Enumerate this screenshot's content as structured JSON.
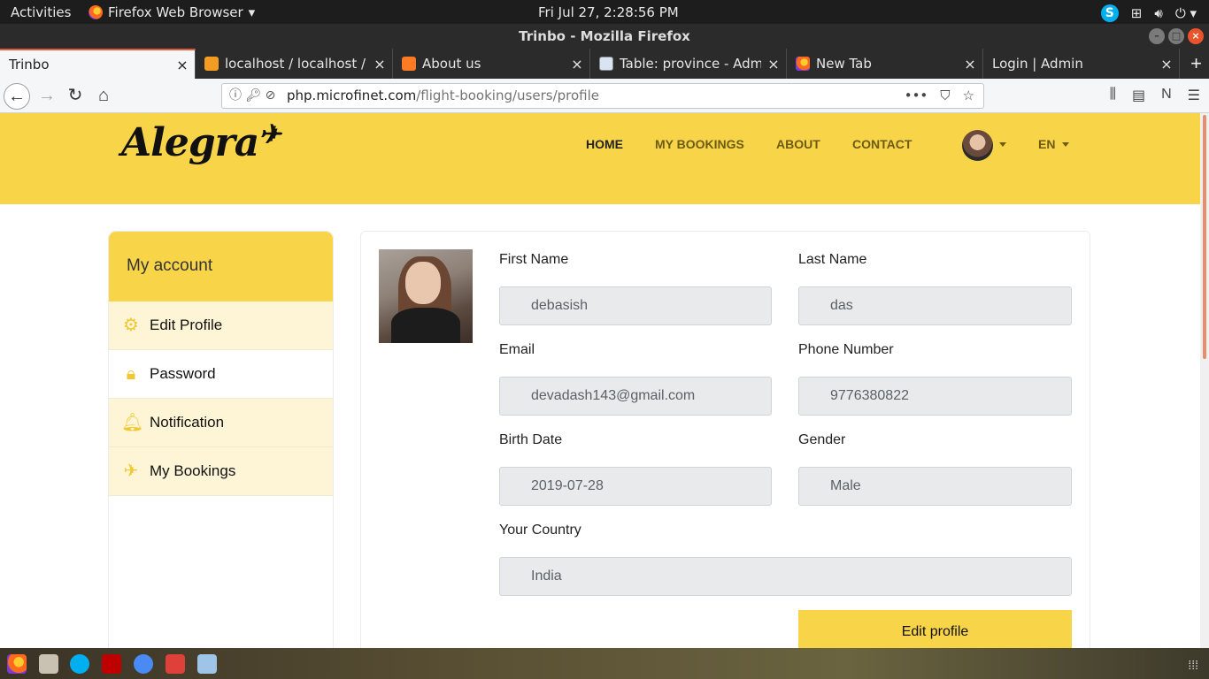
{
  "system": {
    "activities": "Activities",
    "app_menu": "Firefox Web Browser",
    "clock": "Fri Jul 27,  2:28:56 PM"
  },
  "window": {
    "title": "Trinbo - Mozilla Firefox"
  },
  "tabs": [
    {
      "title": "Trinbo",
      "active": true
    },
    {
      "title": "localhost / localhost / fli"
    },
    {
      "title": "About us"
    },
    {
      "title": "Table: province - Admine"
    },
    {
      "title": "New Tab"
    },
    {
      "title": "Login | Admin"
    }
  ],
  "urlbar": {
    "domain": "php.microfinet.com",
    "path": "/flight-booking/users/profile"
  },
  "site": {
    "logo": "Alegra",
    "menu": [
      "HOME",
      "MY BOOKINGS",
      "ABOUT",
      "CONTACT"
    ],
    "language": "EN"
  },
  "sidebar": {
    "heading": "My account",
    "items": [
      {
        "label": "Edit Profile",
        "icon": "gear-icon"
      },
      {
        "label": "Password",
        "icon": "lock-icon"
      },
      {
        "label": "Notification",
        "icon": "bell-icon"
      },
      {
        "label": "My Bookings",
        "icon": "plane-icon"
      }
    ]
  },
  "profile": {
    "first_name": {
      "label": "First Name",
      "value": "debasish"
    },
    "last_name": {
      "label": "Last Name",
      "value": "das"
    },
    "email": {
      "label": "Email",
      "value": "devadash143@gmail.com"
    },
    "phone": {
      "label": "Phone Number",
      "value": "9776380822"
    },
    "birth_date": {
      "label": "Birth Date",
      "value": "2019-07-28"
    },
    "gender": {
      "label": "Gender",
      "value": "Male"
    },
    "country": {
      "label": "Your Country",
      "value": "India"
    },
    "edit_button": "Edit profile"
  },
  "colors": {
    "brand_yellow": "#f8d548",
    "sidebar_tint": "#fdf5d6",
    "input_bg": "#e8eaec"
  }
}
